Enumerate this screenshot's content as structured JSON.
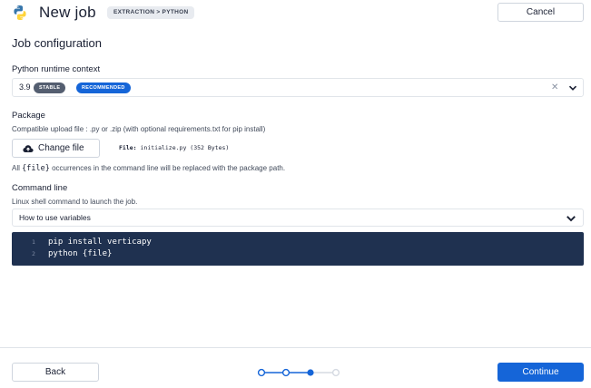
{
  "header": {
    "title": "New job",
    "badge": "EXTRACTION > PYTHON",
    "cancel_label": "Cancel",
    "logo_icon": "python-logo-icon"
  },
  "section_title": "Job configuration",
  "runtime": {
    "label": "Python runtime context",
    "value": "3.9",
    "tags": [
      "STABLE",
      "RECOMMENDED"
    ],
    "clear_icon": "close-icon",
    "dropdown_icon": "chevron-down-icon"
  },
  "package": {
    "label": "Package",
    "description": "Compatible upload file : .py or .zip (with optional requirements.txt for pip install)",
    "change_label": "Change file",
    "upload_icon": "cloud-upload-icon",
    "file_prefix": "File:",
    "file_name": "initialize.py (352 Bytes)",
    "hint_before": "All ",
    "hint_code": "{file}",
    "hint_after": " occurrences in the command line will be replaced with the package path."
  },
  "command": {
    "label": "Command line",
    "description": "Linux shell command to launch the job.",
    "variables_select": "How to use variables",
    "lines": [
      {
        "num": "1",
        "code": "pip install verticapy"
      },
      {
        "num": "2",
        "code": "python {file}"
      }
    ]
  },
  "footer": {
    "back_label": "Back",
    "continue_label": "Continue",
    "steps_total": 4,
    "current_step": 3
  },
  "colors": {
    "primary": "#1565d8",
    "editor_bg": "#1f3150",
    "stable_badge": "#545e70"
  }
}
